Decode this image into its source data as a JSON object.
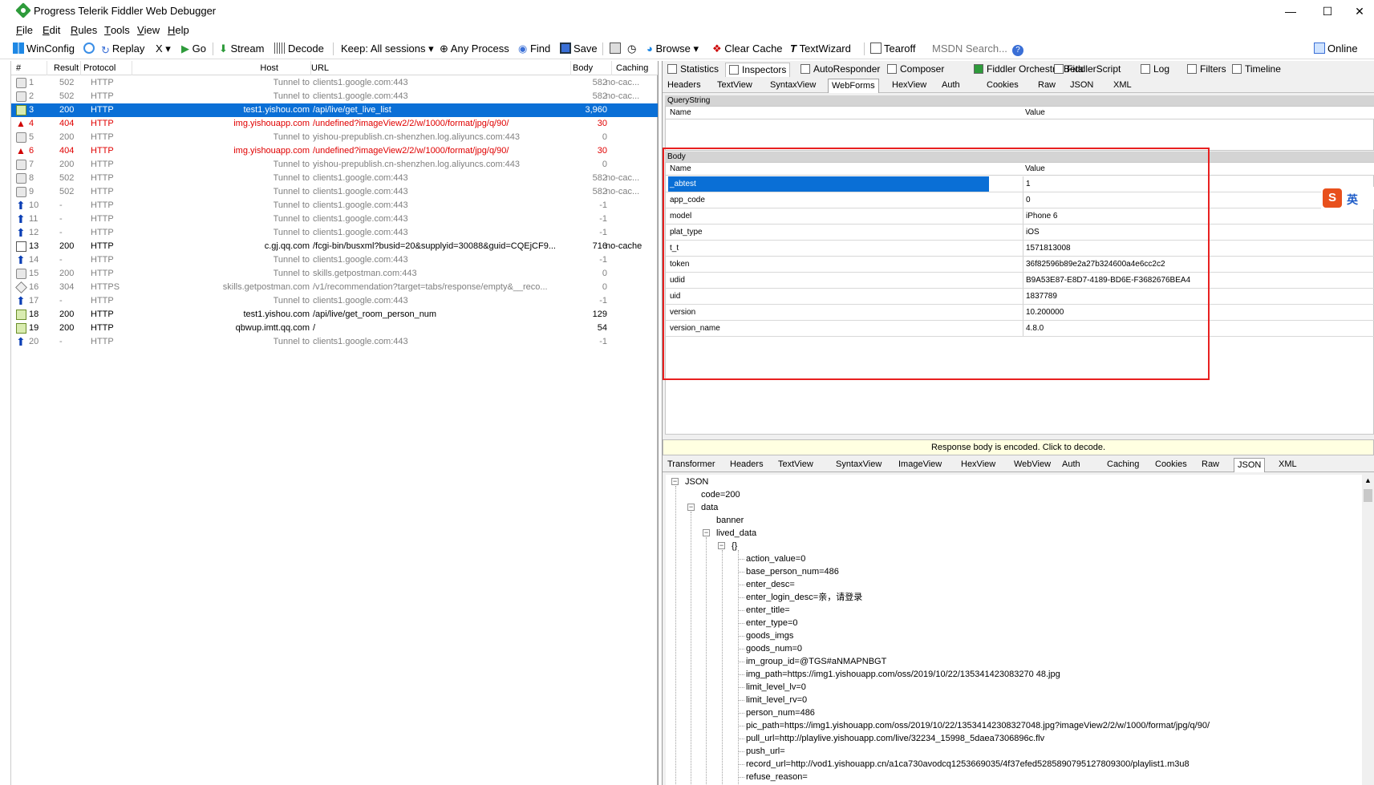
{
  "window": {
    "title": "Progress Telerik Fiddler Web Debugger"
  },
  "menu": [
    {
      "pre": "",
      "u": "F",
      "post": "ile"
    },
    {
      "pre": "",
      "u": "E",
      "post": "dit"
    },
    {
      "pre": "",
      "u": "R",
      "post": "ules"
    },
    {
      "pre": "",
      "u": "T",
      "post": "ools"
    },
    {
      "pre": "",
      "u": "V",
      "post": "iew"
    },
    {
      "pre": "",
      "u": "H",
      "post": "elp"
    }
  ],
  "toolbar": {
    "winconfig": "WinConfig",
    "replay": "Replay",
    "x": "X",
    "go": "Go",
    "stream": "Stream",
    "decode": "Decode",
    "keep": "Keep: All sessions",
    "process": "Any Process",
    "find": "Find",
    "save": "Save",
    "browse": "Browse",
    "clear_cache": "Clear Cache",
    "textwizard": "TextWizard",
    "tearoff": "Tearoff",
    "msdn": "MSDN Search...",
    "online": "Online"
  },
  "sessions": {
    "headers": [
      "#",
      "Result",
      "Protocol",
      "Host",
      "URL",
      "Body",
      "Caching"
    ],
    "rows": [
      {
        "n": "1",
        "result": "502",
        "proto": "HTTP",
        "host": "Tunnel to",
        "url": "clients1.google.com:443",
        "body": "582",
        "caching": "no-cac...",
        "kind": "tun",
        "icon": "lock"
      },
      {
        "n": "2",
        "result": "502",
        "proto": "HTTP",
        "host": "Tunnel to",
        "url": "clients1.google.com:443",
        "body": "582",
        "caching": "no-cac...",
        "kind": "tun",
        "icon": "lock"
      },
      {
        "n": "3",
        "result": "200",
        "proto": "HTTP",
        "host": "test1.yishou.com",
        "url": "/api/live/get_live_list",
        "body": "3,960",
        "caching": "",
        "kind": "sel",
        "icon": "json"
      },
      {
        "n": "4",
        "result": "404",
        "proto": "HTTP",
        "host": "img.yishouapp.com",
        "url": "/undefined?imageView2/2/w/1000/format/jpg/q/90/",
        "body": "30",
        "caching": "",
        "kind": "err",
        "icon": "warn"
      },
      {
        "n": "5",
        "result": "200",
        "proto": "HTTP",
        "host": "Tunnel to",
        "url": "yishou-prepublish.cn-shenzhen.log.aliyuncs.com:443",
        "body": "0",
        "caching": "",
        "kind": "tun",
        "icon": "lock"
      },
      {
        "n": "6",
        "result": "404",
        "proto": "HTTP",
        "host": "img.yishouapp.com",
        "url": "/undefined?imageView2/2/w/1000/format/jpg/q/90/",
        "body": "30",
        "caching": "",
        "kind": "err",
        "icon": "warn"
      },
      {
        "n": "7",
        "result": "200",
        "proto": "HTTP",
        "host": "Tunnel to",
        "url": "yishou-prepublish.cn-shenzhen.log.aliyuncs.com:443",
        "body": "0",
        "caching": "",
        "kind": "tun",
        "icon": "lock"
      },
      {
        "n": "8",
        "result": "502",
        "proto": "HTTP",
        "host": "Tunnel to",
        "url": "clients1.google.com:443",
        "body": "582",
        "caching": "no-cac...",
        "kind": "tun",
        "icon": "lock"
      },
      {
        "n": "9",
        "result": "502",
        "proto": "HTTP",
        "host": "Tunnel to",
        "url": "clients1.google.com:443",
        "body": "582",
        "caching": "no-cac...",
        "kind": "tun",
        "icon": "lock"
      },
      {
        "n": "10",
        "result": "-",
        "proto": "HTTP",
        "host": "Tunnel to",
        "url": "clients1.google.com:443",
        "body": "-1",
        "caching": "",
        "kind": "tun",
        "icon": "up"
      },
      {
        "n": "11",
        "result": "-",
        "proto": "HTTP",
        "host": "Tunnel to",
        "url": "clients1.google.com:443",
        "body": "-1",
        "caching": "",
        "kind": "tun",
        "icon": "up"
      },
      {
        "n": "12",
        "result": "-",
        "proto": "HTTP",
        "host": "Tunnel to",
        "url": "clients1.google.com:443",
        "body": "-1",
        "caching": "",
        "kind": "tun",
        "icon": "up"
      },
      {
        "n": "13",
        "result": "200",
        "proto": "HTTP",
        "host": "c.gj.qq.com",
        "url": "/fcgi-bin/busxml?busid=20&supplyid=30088&guid=CQEjCF9...",
        "body": "716",
        "caching": "no-cache",
        "kind": "norm",
        "icon": "doc"
      },
      {
        "n": "14",
        "result": "-",
        "proto": "HTTP",
        "host": "Tunnel to",
        "url": "clients1.google.com:443",
        "body": "-1",
        "caching": "",
        "kind": "tun",
        "icon": "up"
      },
      {
        "n": "15",
        "result": "200",
        "proto": "HTTP",
        "host": "Tunnel to",
        "url": "skills.getpostman.com:443",
        "body": "0",
        "caching": "",
        "kind": "tun",
        "icon": "lock"
      },
      {
        "n": "16",
        "result": "304",
        "proto": "HTTPS",
        "host": "skills.getpostman.com",
        "url": "/v1/recommendation?target=tabs/response/empty&__reco...",
        "body": "0",
        "caching": "",
        "kind": "tun",
        "icon": "diamond"
      },
      {
        "n": "17",
        "result": "-",
        "proto": "HTTP",
        "host": "Tunnel to",
        "url": "clients1.google.com:443",
        "body": "-1",
        "caching": "",
        "kind": "tun",
        "icon": "up"
      },
      {
        "n": "18",
        "result": "200",
        "proto": "HTTP",
        "host": "test1.yishou.com",
        "url": "/api/live/get_room_person_num",
        "body": "129",
        "caching": "",
        "kind": "norm",
        "icon": "json"
      },
      {
        "n": "19",
        "result": "200",
        "proto": "HTTP",
        "host": "qbwup.imtt.qq.com",
        "url": "/",
        "body": "54",
        "caching": "",
        "kind": "norm",
        "icon": "json"
      },
      {
        "n": "20",
        "result": "-",
        "proto": "HTTP",
        "host": "Tunnel to",
        "url": "clients1.google.com:443",
        "body": "-1",
        "caching": "",
        "kind": "tun",
        "icon": "up"
      }
    ]
  },
  "inspector_tabs": [
    "Statistics",
    "Inspectors",
    "AutoResponder",
    "Composer",
    "Fiddler Orchestra Beta",
    "FiddlerScript",
    "Log",
    "Filters",
    "Timeline"
  ],
  "request_tabs": [
    "Headers",
    "TextView",
    "SyntaxView",
    "WebForms",
    "HexView",
    "Auth",
    "Cookies",
    "Raw",
    "JSON",
    "XML"
  ],
  "querystring": {
    "title": "QueryString",
    "name_col": "Name",
    "value_col": "Value"
  },
  "body": {
    "title": "Body",
    "name_col": "Name",
    "value_col": "Value",
    "rows": [
      {
        "name": "_abtest",
        "value": "1"
      },
      {
        "name": "app_code",
        "value": "0"
      },
      {
        "name": "model",
        "value": "iPhone 6"
      },
      {
        "name": "plat_type",
        "value": "iOS"
      },
      {
        "name": "t_t",
        "value": "1571813008"
      },
      {
        "name": "token",
        "value": "36f82596b89e2a27b324600a4e6cc2c2"
      },
      {
        "name": "udid",
        "value": "B9A53E87-E8D7-4189-BD6E-F3682676BEA4"
      },
      {
        "name": "uid",
        "value": "1837789"
      },
      {
        "name": "version",
        "value": "10.200000"
      },
      {
        "name": "version_name",
        "value": "4.8.0"
      }
    ]
  },
  "notice": "Response body is encoded. Click to decode.",
  "response_tabs": [
    "Transformer",
    "Headers",
    "TextView",
    "SyntaxView",
    "ImageView",
    "HexView",
    "WebView",
    "Auth",
    "Caching",
    "Cookies",
    "Raw",
    "JSON",
    "XML"
  ],
  "json_tree": {
    "root": "JSON",
    "code": "code=200",
    "data": "data",
    "banner": "banner",
    "lived_data": "lived_data",
    "obj": "{}",
    "fields": [
      "action_value=0",
      "base_person_num=486",
      "enter_desc=",
      "enter_login_desc=亲，请登录",
      "enter_title=",
      "enter_type=0",
      "goods_imgs",
      "goods_num=0",
      "im_group_id=@TGS#aNMAPNBGT",
      "img_path=https://img1.yishouapp.com/oss/2019/10/22/135341423083270 48.jpg",
      "limit_level_lv=0",
      "limit_level_rv=0",
      "person_num=486",
      "pic_path=https://img1.yishouapp.com/oss/2019/10/22/13534142308327048.jpg?imageView2/2/w/1000/format/jpg/q/90/",
      "pull_url=http://playlive.yishouapp.com/live/32234_15998_5daea7306896c.flv",
      "push_url=",
      "record_url=http://vod1.yishouapp.cn/a1ca730avodcq1253669035/4f37efed5285890795127809300/playlist1.m3u8",
      "refuse_reason="
    ]
  },
  "ime": {
    "label": "英"
  },
  "colors": {
    "selection": "#0a6fd6",
    "error": "#e00000",
    "highlight_box": "#e82020"
  }
}
